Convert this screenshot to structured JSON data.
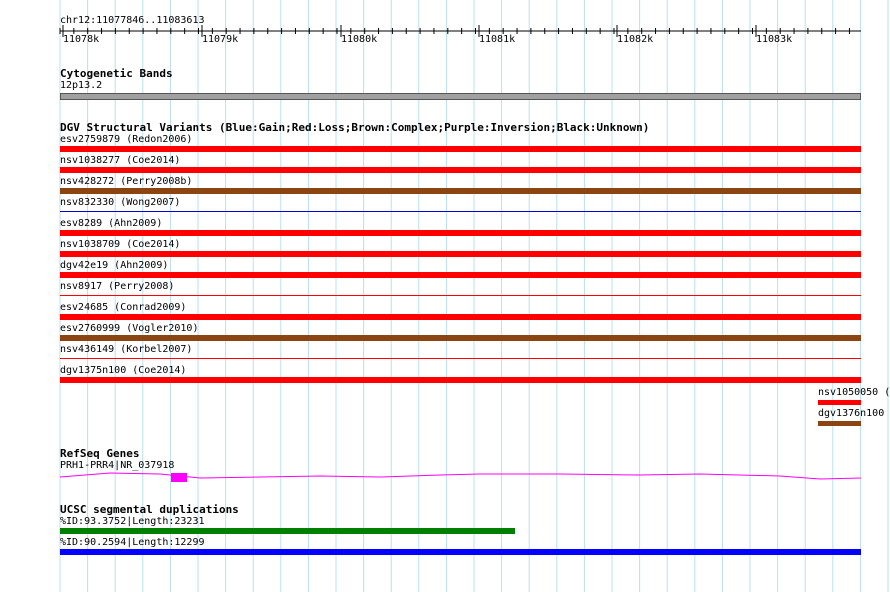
{
  "ruler": {
    "location": "chr12:11077846..11083613",
    "ticks": [
      "11078k",
      "11079k",
      "11080k",
      "11081k",
      "11082k",
      "11083k"
    ]
  },
  "cytoband": {
    "title": "Cytogenetic Bands",
    "label": "12p13.2",
    "color": "#a0a0a0"
  },
  "dgv": {
    "title": "DGV Structural Variants (Blue:Gain;Red:Loss;Brown:Complex;Purple:Inversion;Black:Unknown)",
    "features": [
      {
        "label": "esv2759879 (Redon2006)",
        "color": "#ff0000"
      },
      {
        "label": "nsv1038277 (Coe2014)",
        "color": "#ff0000"
      },
      {
        "label": "nsv428272 (Perry2008b)",
        "color": "#8b4513"
      },
      {
        "label": "nsv832330 (Wong2007)",
        "color": "#0000cd"
      },
      {
        "label": "esv8289 (Ahn2009)",
        "color": "#ff0000"
      },
      {
        "label": "nsv1038709 (Coe2014)",
        "color": "#ff0000"
      },
      {
        "label": "dgv42e19 (Ahn2009)",
        "color": "#ff0000"
      },
      {
        "label": "nsv8917 (Perry2008)",
        "color": "#ff0000"
      },
      {
        "label": "esv24685 (Conrad2009)",
        "color": "#ff0000"
      },
      {
        "label": "esv2760999 (Vogler2010)",
        "color": "#8b4513"
      },
      {
        "label": "nsv436149 (Korbel2007)",
        "color": "#ff0000"
      },
      {
        "label": "dgv1375n100 (Coe2014)",
        "color": "#ff0000"
      }
    ],
    "right_features": [
      {
        "label": "nsv1050050 (",
        "color": "#ff0000"
      },
      {
        "label": "dgv1376n100",
        "color": "#8b4513"
      }
    ]
  },
  "refseq": {
    "title": "RefSeq Genes",
    "label": "PRH1-PRR4|NR_037918",
    "color": "#ff00ff"
  },
  "segdups": {
    "title": "UCSC segmental duplications",
    "features": [
      {
        "label": "%ID:93.3752|Length:23231",
        "color": "#008000"
      },
      {
        "label": "%ID:90.2594|Length:12299",
        "color": "#0000ff"
      }
    ]
  }
}
